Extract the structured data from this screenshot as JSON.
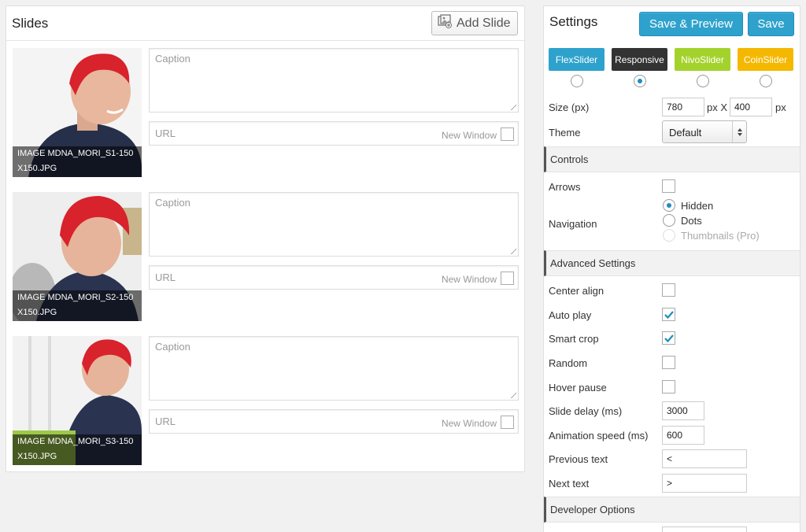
{
  "slides_panel": {
    "title": "Slides",
    "add_slide_label": "Add Slide",
    "slides": [
      {
        "image_label": "IMAGE MDNA_MORI_S1-150X150.JPG",
        "caption_placeholder": "Caption",
        "url_placeholder": "URL",
        "new_window_label": "New Window"
      },
      {
        "image_label": "IMAGE MDNA_MORI_S2-150X150.JPG",
        "caption_placeholder": "Caption",
        "url_placeholder": "URL",
        "new_window_label": "New Window"
      },
      {
        "image_label": "IMAGE MDNA_MORI_S3-150X150.JPG",
        "caption_placeholder": "Caption",
        "url_placeholder": "URL",
        "new_window_label": "New Window"
      }
    ]
  },
  "settings": {
    "title": "Settings",
    "save_preview_label": "Save & Preview",
    "save_label": "Save",
    "libraries": [
      {
        "label": "FlexSlider",
        "color": "#2ea2cc",
        "selected": false
      },
      {
        "label": "Responsive",
        "color": "#333333",
        "selected": true
      },
      {
        "label": "NivoSlider",
        "color": "#a4d22c",
        "selected": false
      },
      {
        "label": "CoinSlider",
        "color": "#f5b800",
        "selected": false
      }
    ],
    "size_label": "Size (px)",
    "width": "780",
    "px_x": "px X",
    "height": "400",
    "px": "px",
    "theme_label": "Theme",
    "theme_value": "Default",
    "controls_heading": "Controls",
    "arrows_label": "Arrows",
    "navigation_label": "Navigation",
    "navigation_options": [
      "Hidden",
      "Dots",
      "Thumbnails (Pro)"
    ],
    "advanced_heading": "Advanced Settings",
    "center_align_label": "Center align",
    "auto_play_label": "Auto play",
    "smart_crop_label": "Smart crop",
    "random_label": "Random",
    "hover_pause_label": "Hover pause",
    "slide_delay_label": "Slide delay (ms)",
    "slide_delay_value": "3000",
    "animation_speed_label": "Animation speed (ms)",
    "animation_speed_value": "600",
    "previous_text_label": "Previous text",
    "previous_text_value": "<",
    "next_text_label": "Next text",
    "next_text_value": ">",
    "developer_heading": "Developer Options"
  },
  "colors": {
    "accent": "#2ea2cc",
    "accent_border": "#1e8cbe"
  }
}
